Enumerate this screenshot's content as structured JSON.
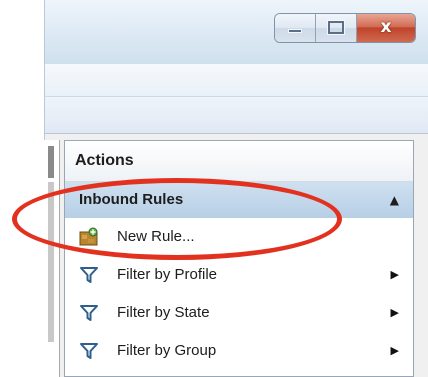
{
  "window": {
    "close_glyph": "x",
    "minimize_icon": "minimize-icon",
    "maximize_icon": "maximize-icon",
    "close_icon": "close-icon"
  },
  "actions": {
    "title": "Actions",
    "section": {
      "label": "Inbound Rules",
      "collapse_icon": "collapse-up-icon",
      "collapse_glyph": "▲"
    },
    "items": [
      {
        "label": "New Rule...",
        "icon": "new-rule-icon",
        "has_submenu": false
      },
      {
        "label": "Filter by Profile",
        "icon": "filter-icon",
        "has_submenu": true
      },
      {
        "label": "Filter by State",
        "icon": "filter-icon",
        "has_submenu": true
      },
      {
        "label": "Filter by Group",
        "icon": "filter-icon",
        "has_submenu": true
      }
    ],
    "submenu_glyph": "▶"
  },
  "annotation": {
    "highlight_color": "#e2321f"
  },
  "colors": {
    "filter_icon": "#2f5f8c",
    "section_header": "#bcd3e9"
  }
}
